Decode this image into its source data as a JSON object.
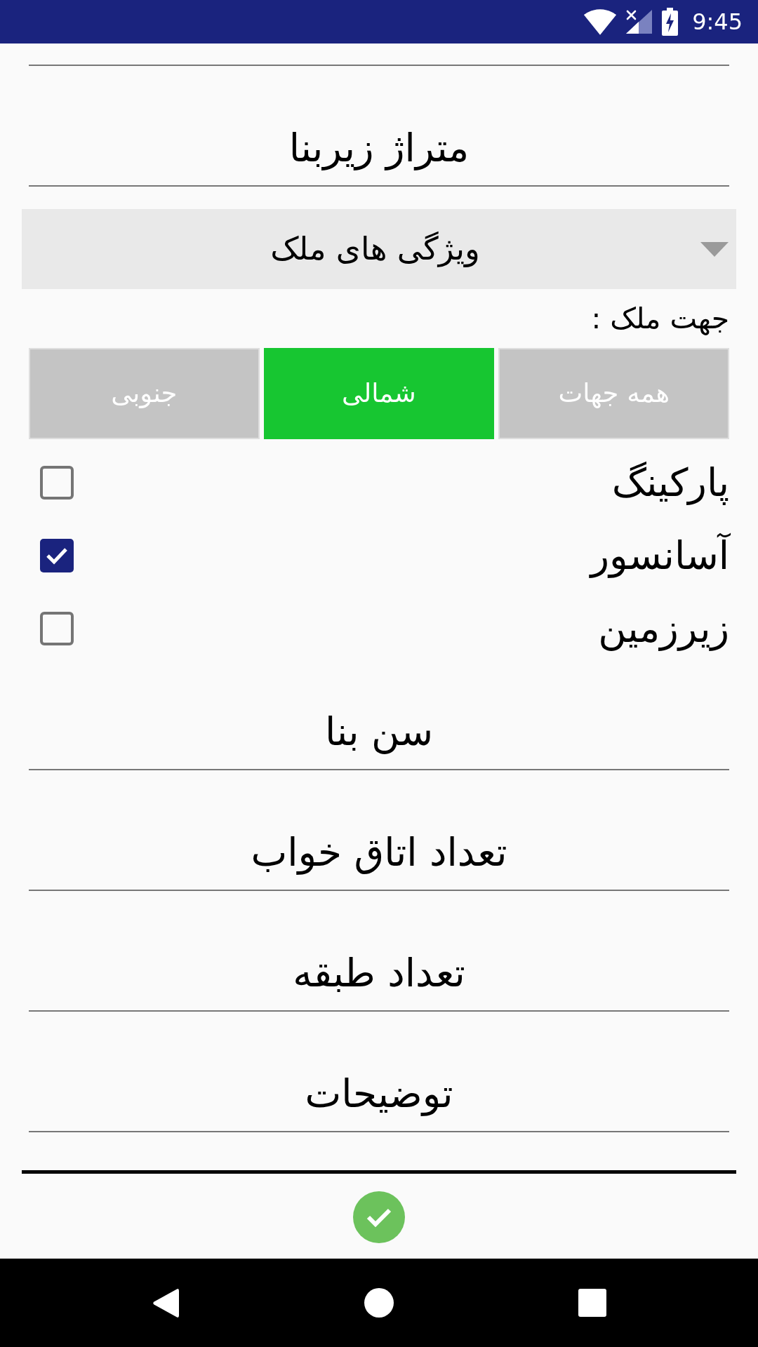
{
  "status_bar": {
    "time": "9:45"
  },
  "area_field": {
    "placeholder": "متراژ زیربنا"
  },
  "features_dropdown": {
    "value": "ویژگی های ملک"
  },
  "direction": {
    "label": "جهت ملک :",
    "options": [
      {
        "label": "همه جهات",
        "selected": false
      },
      {
        "label": "شمالی",
        "selected": true
      },
      {
        "label": "جنوبی",
        "selected": false
      }
    ]
  },
  "amenities": [
    {
      "label": "پارکینگ",
      "checked": false
    },
    {
      "label": "آسانسور",
      "checked": true
    },
    {
      "label": "زیرزمین",
      "checked": false
    }
  ],
  "fields": [
    {
      "placeholder": "سن بنا"
    },
    {
      "placeholder": "تعداد اتاق خواب"
    },
    {
      "placeholder": "تعداد طبقه"
    },
    {
      "placeholder": "توضیحات"
    }
  ]
}
